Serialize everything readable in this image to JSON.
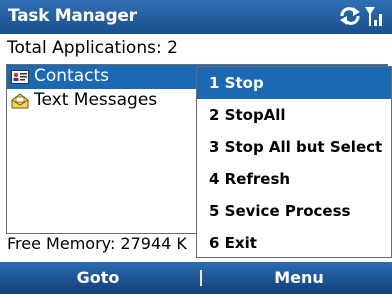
{
  "window": {
    "title": "Task Manager"
  },
  "status_icons": [
    "sync-icon",
    "signal-icon"
  ],
  "summary": {
    "total_applications": "Total Applications: 2"
  },
  "applications": [
    {
      "label": "Contacts",
      "icon": "contacts-icon",
      "selected": true
    },
    {
      "label": "Text Messages",
      "icon": "text-messages-icon",
      "selected": false
    }
  ],
  "memory": {
    "free_memory": "Free Memory: 27944 K"
  },
  "menu": {
    "items": [
      {
        "label": "1 Stop",
        "selected": true
      },
      {
        "label": "2 StopAll",
        "selected": false
      },
      {
        "label": "3 Stop All but Select",
        "selected": false
      },
      {
        "label": "4 Refresh",
        "selected": false
      },
      {
        "label": "5 Sevice Process",
        "selected": false
      },
      {
        "label": "6 Exit",
        "selected": false
      }
    ]
  },
  "softkeys": {
    "left": "Goto",
    "right": "Menu"
  },
  "colors": {
    "title_bar": "#1a4f8c",
    "selection": "#1a69b2",
    "softkey_bar": "#1e5496"
  }
}
